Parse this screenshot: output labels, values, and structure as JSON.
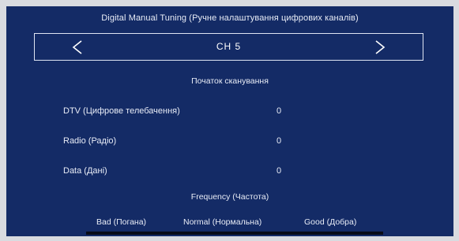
{
  "title": "Digital Manual Tuning (Ручне налаштування цифрових каналів)",
  "channel": {
    "label": "CH 5",
    "prev_icon": "chevron-left-icon",
    "next_icon": "chevron-right-icon"
  },
  "scan_start": "Початок сканування",
  "results": {
    "dtv": {
      "label": "DTV (Цифрове телебачення)",
      "value": "0"
    },
    "radio": {
      "label": "Radio (Радіо)",
      "value": "0"
    },
    "data": {
      "label": "Data (Дані)",
      "value": "0"
    }
  },
  "frequency": {
    "label": "Frequency (Частота)",
    "quality": {
      "bad": "Bad (Погана)",
      "normal": "Normal (Нормальна)",
      "good": "Good (Добра)"
    }
  },
  "colors": {
    "background": "#142b66",
    "text": "#e8ecf6",
    "signal_bar": "#080c18"
  }
}
